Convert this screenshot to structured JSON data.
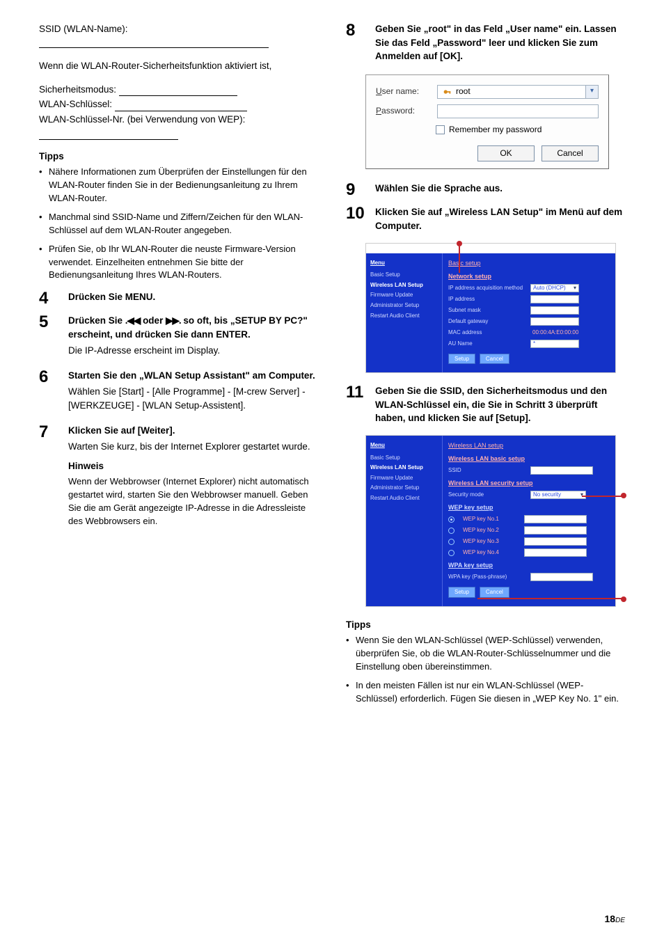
{
  "left": {
    "ssid_label": "SSID (WLAN-Name):",
    "intro_para": "Wenn die WLAN-Router-Sicherheitsfunktion aktiviert ist,",
    "sec_mode_label": "Sicherheitsmodus:",
    "key_label": "WLAN-Schlüssel:",
    "key_nr_label": "WLAN-Schlüssel-Nr. (bei Verwendung von WEP):",
    "tipps_head": "Tipps",
    "tips": [
      "Nähere Informationen zum Überprüfen der Einstellungen für den WLAN-Router finden Sie in der Bedienungsanleitung zu Ihrem WLAN-Router.",
      "Manchmal sind SSID-Name und Ziffern/Zeichen für den WLAN-Schlüssel auf dem WLAN-Router angegeben.",
      "Prüfen Sie, ob Ihr WLAN-Router die neuste Firmware-Version verwendet. Einzelheiten entnehmen Sie bitte der Bedienungsanleitung Ihres WLAN-Routers."
    ],
    "step4_title": "Drücken Sie MENU.",
    "step5_title_a": "Drücken Sie ",
    "step5_title_b": " oder ",
    "step5_title_c": " so oft, bis „SETUP BY PC?\" erscheint, und drücken Sie dann ENTER.",
    "skip_prev": "⏮",
    "skip_next": "⏭",
    "step5_text": "Die IP-Adresse erscheint im Display.",
    "step6_title": "Starten Sie den „WLAN Setup Assistant\" am Computer.",
    "step6_text": "Wählen Sie [Start] - [Alle Programme] - [M-crew Server] - [WERKZEUGE] - [WLAN Setup-Assistent].",
    "step7_title": "Klicken Sie auf [Weiter].",
    "step7_text": "Warten Sie kurz, bis der Internet Explorer gestartet wurde.",
    "hinweis_head": "Hinweis",
    "hinweis_text": "Wenn der Webbrowser (Internet Explorer) nicht automatisch gestartet wird, starten Sie den Webbrowser manuell. Geben Sie die am Gerät angezeigte IP-Adresse in die Adressleiste des Webbrowsers ein."
  },
  "right": {
    "step8_title": "Geben Sie „root\" in das Feld „User name\" ein. Lassen Sie das Feld „Password\" leer und klicken Sie zum Anmelden auf [OK].",
    "login": {
      "user_label_pre": "U",
      "user_label_rest": "ser name:",
      "pass_label_pre": "P",
      "pass_label_rest": "assword:",
      "user_value": "root",
      "remember_pre": "R",
      "remember_rest": "emember my password",
      "ok": "OK",
      "cancel": "Cancel"
    },
    "step9_title": "Wählen Sie die Sprache aus.",
    "step10_title": "Klicken Sie auf „Wireless LAN Setup\" im Menü auf dem Computer.",
    "router1": {
      "menu_head": "Menu",
      "items": [
        "Basic Setup",
        "Wireless LAN Setup",
        "Firmware Update",
        "Administrator Setup",
        "Restart Audio Client"
      ],
      "crumb": "Basic setup",
      "sec": "Network setup",
      "f1": "IP address acquisition method",
      "f1v": "Auto (DHCP)",
      "f2": "IP address",
      "f3": "Subnet mask",
      "f4": "Default gateway",
      "f5": "MAC address",
      "f5v": "00:00:4A:E0:00:00",
      "f6": "AU Name",
      "f6v": "*",
      "btn_setup": "Setup",
      "btn_cancel": "Cancel"
    },
    "step11_title": "Geben Sie die SSID, den Sicherheitsmodus und den WLAN-Schlüssel ein, die Sie in Schritt 3 überprüft haben, und klicken Sie auf [Setup].",
    "router2": {
      "menu_head": "Menu",
      "items": [
        "Basic Setup",
        "Wireless LAN Setup",
        "Firmware Update",
        "Administrator Setup",
        "Restart Audio Client"
      ],
      "crumb": "Wireless LAN setup",
      "sec1": "Wireless LAN basic setup",
      "f_ssid": "SSID",
      "sec2": "Wireless LAN security setup",
      "f_secmode": "Security mode",
      "f_secmode_v": "No security",
      "sec3": "WEP key setup",
      "wep1": "WEP key No.1",
      "wep2": "WEP key No.2",
      "wep3": "WEP key No.3",
      "wep4": "WEP key No.4",
      "sec4": "WPA key setup",
      "wpa": "WPA key (Pass-phrase)",
      "btn_setup": "Setup",
      "btn_cancel": "Cancel"
    },
    "tipps_head": "Tipps",
    "tips": [
      "Wenn Sie den WLAN-Schlüssel (WEP-Schlüssel) verwenden, überprüfen Sie, ob die WLAN-Router-Schlüsselnummer und die Einstellung oben übereinstimmen.",
      "In den meisten Fällen ist nur ein WLAN-Schlüssel (WEP-Schlüssel) erforderlich. Fügen Sie diesen in „WEP Key No. 1\" ein."
    ]
  },
  "page": {
    "num": "18",
    "suffix": "DE"
  }
}
